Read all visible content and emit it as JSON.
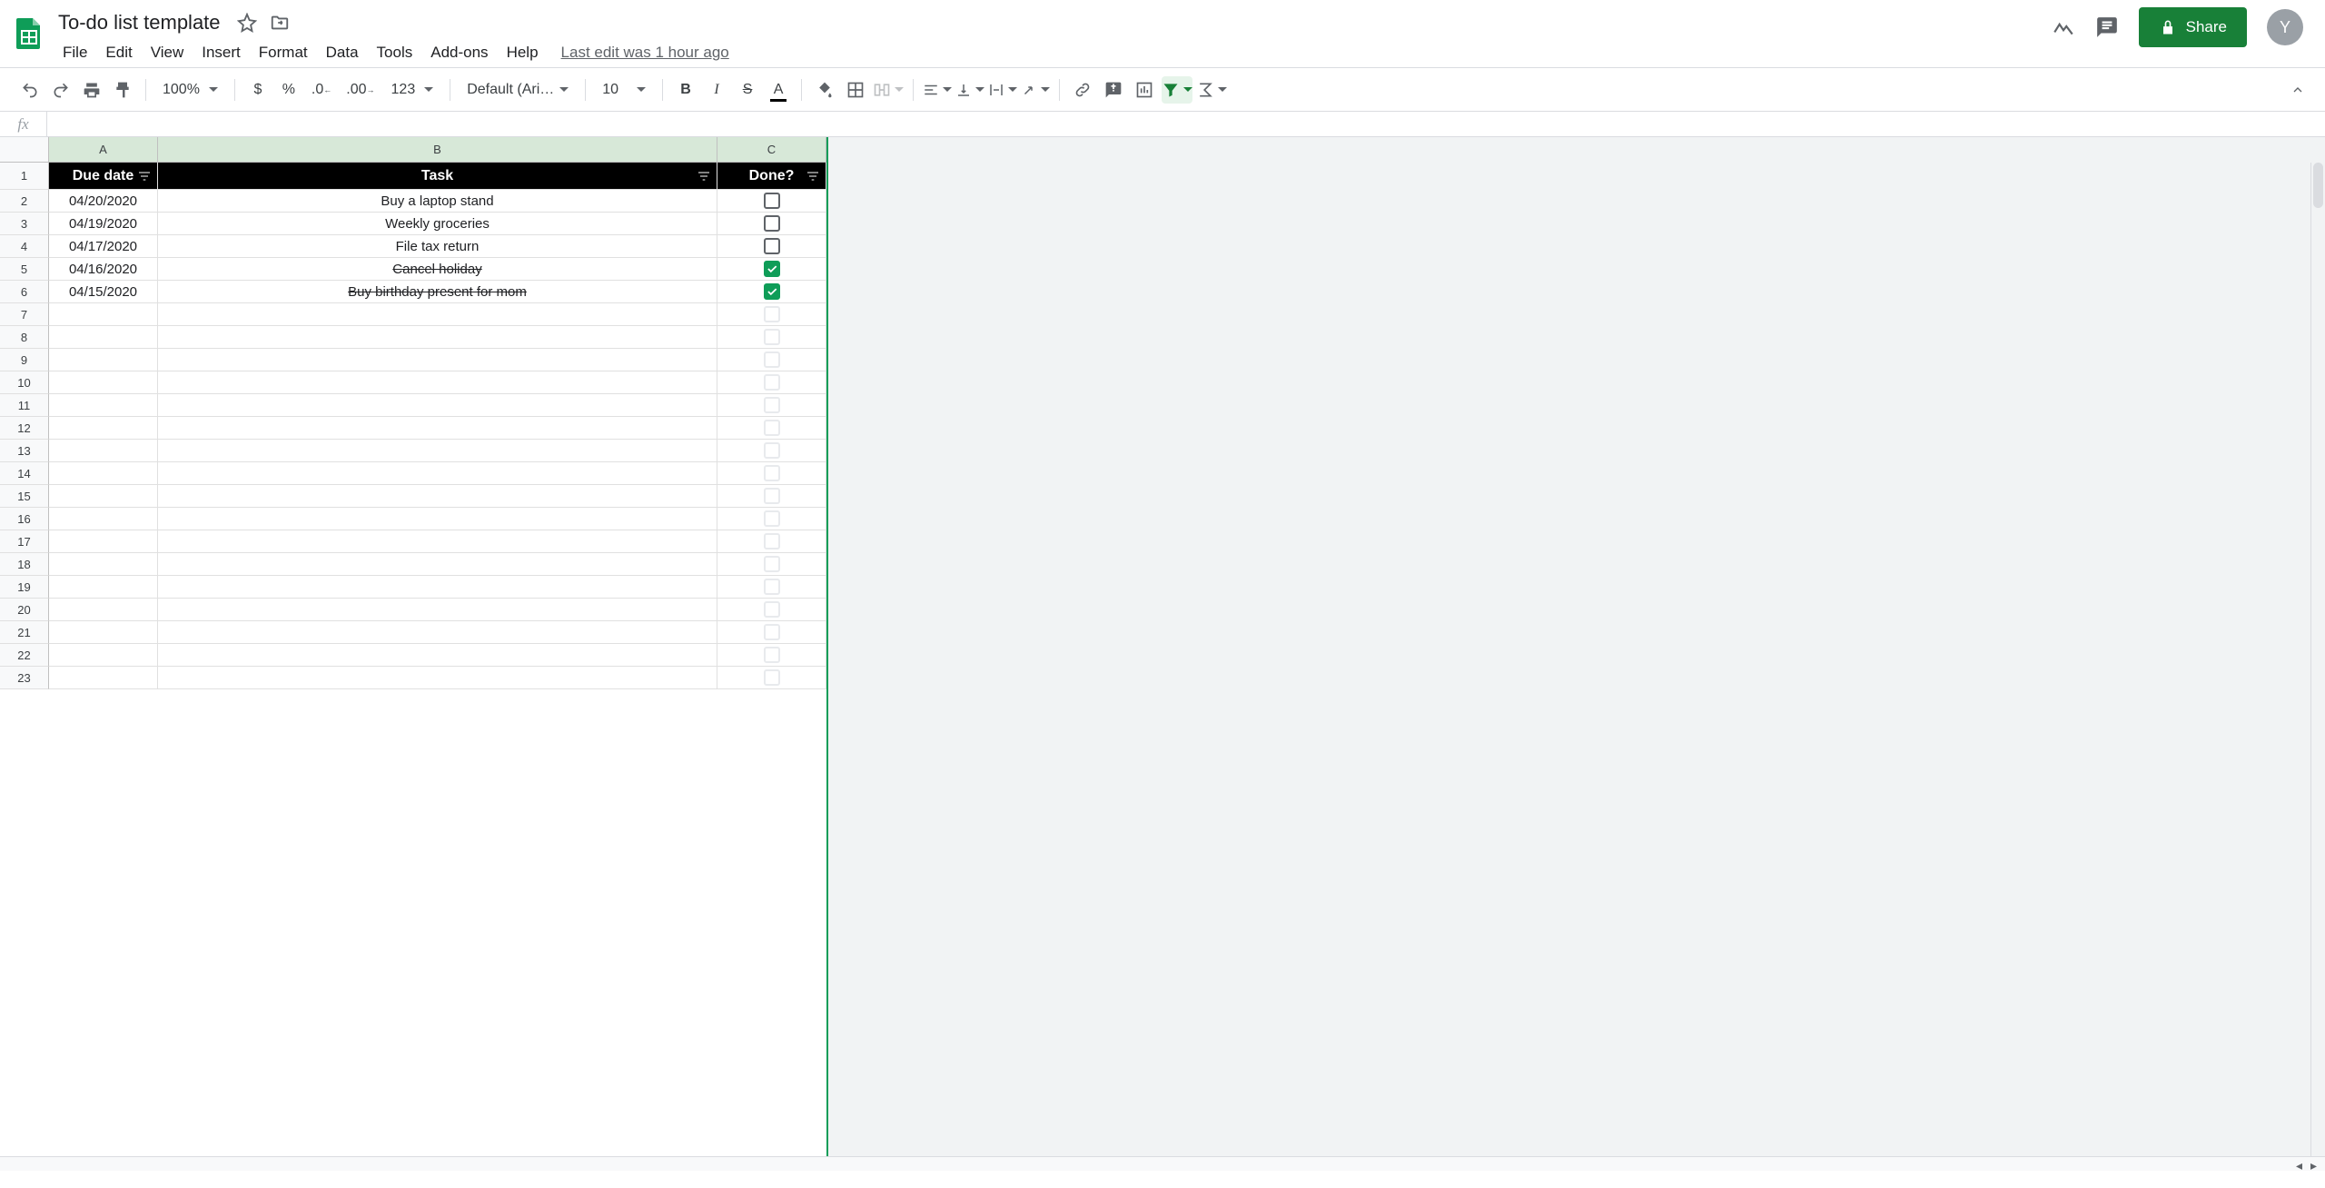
{
  "doc": {
    "title": "To-do list template",
    "avatar_letter": "Y"
  },
  "menus": [
    "File",
    "Edit",
    "View",
    "Insert",
    "Format",
    "Data",
    "Tools",
    "Add-ons",
    "Help"
  ],
  "last_edit": "Last edit was 1 hour ago",
  "share_label": "Share",
  "toolbar": {
    "zoom": "100%",
    "format_123": "123",
    "font": "Default (Ari…",
    "font_size": "10"
  },
  "columns": [
    "A",
    "B",
    "C"
  ],
  "headers": {
    "due": "Due date",
    "task": "Task",
    "done": "Done?"
  },
  "rows": [
    {
      "due": "04/20/2020",
      "task": "Buy a laptop stand",
      "done": false
    },
    {
      "due": "04/19/2020",
      "task": "Weekly groceries",
      "done": false
    },
    {
      "due": "04/17/2020",
      "task": "File tax return",
      "done": false
    },
    {
      "due": "04/16/2020",
      "task": "Cancel holiday",
      "done": true
    },
    {
      "due": "04/15/2020",
      "task": "Buy birthday present for mom",
      "done": true
    }
  ],
  "empty_row_start": 7,
  "empty_row_end": 23
}
